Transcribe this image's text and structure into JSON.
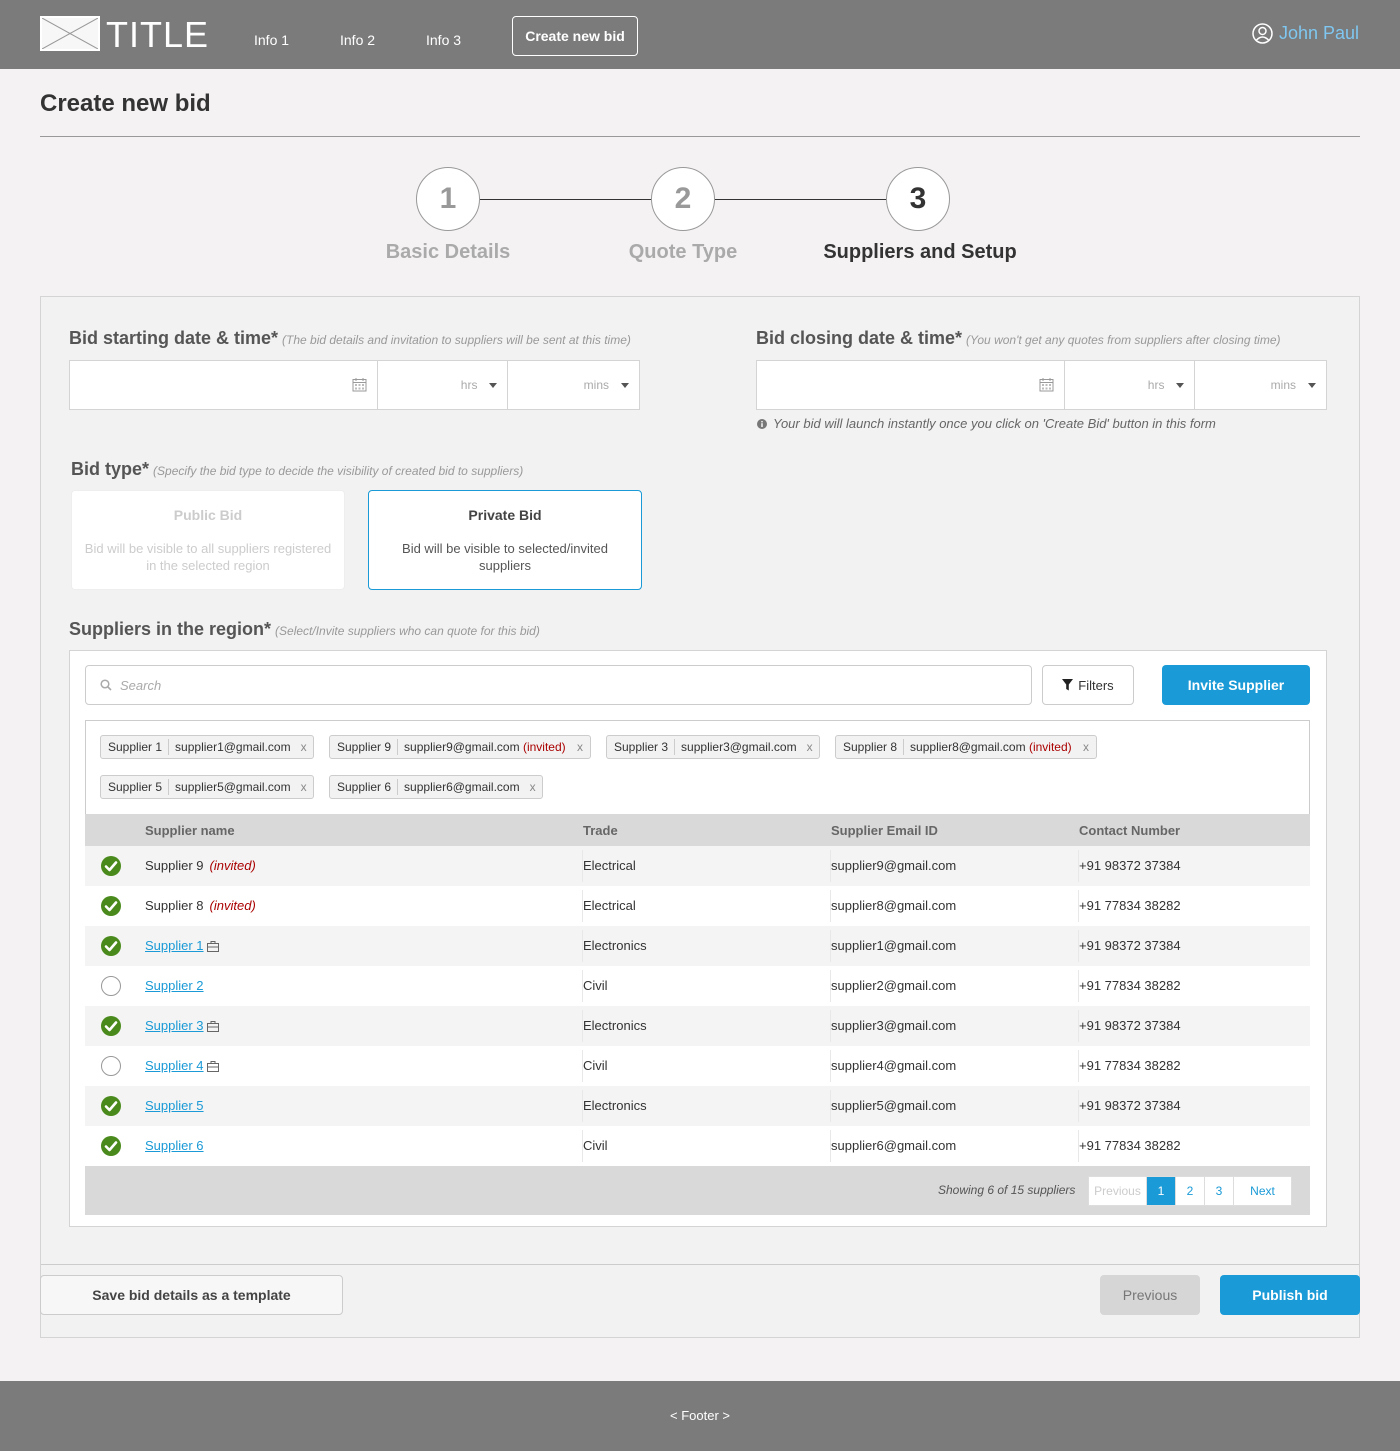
{
  "header": {
    "brand": "TITLE",
    "nav": [
      "Info 1",
      "Info 2",
      "Info 3"
    ],
    "create_button": "Create new bid",
    "user_name": "John Paul"
  },
  "page": {
    "title": "Create new bid"
  },
  "stepper": {
    "steps": [
      {
        "number": "1",
        "label": "Basic Details"
      },
      {
        "number": "2",
        "label": "Quote Type"
      },
      {
        "number": "3",
        "label": "Suppliers and Setup"
      }
    ],
    "active_step": 3
  },
  "form": {
    "start": {
      "label": "Bid starting date & time*",
      "hint": "(The bid details and invitation to suppliers will be sent at this time)",
      "hrs": "hrs",
      "mins": "mins"
    },
    "close": {
      "label": "Bid closing date & time*",
      "hint": "(You won't get any quotes from suppliers after closing time)",
      "hrs": "hrs",
      "mins": "mins",
      "note": "Your bid will launch instantly once you click on 'Create Bid' button in this form"
    },
    "bid_type": {
      "label": "Bid type*",
      "hint": "(Specify the bid type to decide the visibility of created bid to suppliers)",
      "public_title": "Public Bid",
      "public_desc": "Bid will be visible to all suppliers registered in the selected region",
      "private_title": "Private Bid",
      "private_desc": "Bid will be visible to selected/invited suppliers",
      "selected": "Private Bid"
    },
    "suppliers": {
      "label": "Suppliers in the region*",
      "hint": "(Select/Invite suppliers who can quote for this bid)",
      "search_placeholder": "Search",
      "filters_label": "Filters",
      "invite_label": "Invite Supplier"
    }
  },
  "tags": [
    {
      "name": "Supplier 1",
      "email": "supplier1@gmail.com",
      "invited": ""
    },
    {
      "name": "Supplier 9",
      "email": "supplier9@gmail.com",
      "invited": "(invited)"
    },
    {
      "name": "Supplier 3",
      "email": "supplier3@gmail.com",
      "invited": ""
    },
    {
      "name": "Supplier 8",
      "email": "supplier8@gmail.com",
      "invited": "(invited)"
    },
    {
      "name": "Supplier 5",
      "email": "supplier5@gmail.com",
      "invited": ""
    },
    {
      "name": "Supplier 6",
      "email": "supplier6@gmail.com",
      "invited": ""
    }
  ],
  "tag_remove": "x",
  "table": {
    "headers": [
      "Supplier name",
      "Trade",
      "Supplier Email ID",
      "Contact Number"
    ],
    "rows": [
      {
        "name": "Supplier 9",
        "invited": "(invited)",
        "trade": "Electrical",
        "email": "supplier9@gmail.com",
        "phone": "+91 98372 37384",
        "checked": true,
        "link": false,
        "briefcase": false
      },
      {
        "name": "Supplier 8",
        "invited": "(invited)",
        "trade": "Electrical",
        "email": "supplier8@gmail.com",
        "phone": "+91 77834 38282",
        "checked": true,
        "link": false,
        "briefcase": false
      },
      {
        "name": "Supplier 1",
        "invited": "",
        "trade": "Electronics",
        "email": "supplier1@gmail.com",
        "phone": "+91 98372 37384",
        "checked": true,
        "link": true,
        "briefcase": true
      },
      {
        "name": "Supplier 2",
        "invited": "",
        "trade": "Civil",
        "email": "supplier2@gmail.com",
        "phone": "+91 77834 38282",
        "checked": false,
        "link": true,
        "briefcase": false
      },
      {
        "name": "Supplier 3",
        "invited": "",
        "trade": "Electronics",
        "email": "supplier3@gmail.com",
        "phone": "+91 98372 37384",
        "checked": true,
        "link": true,
        "briefcase": true
      },
      {
        "name": "Supplier 4",
        "invited": "",
        "trade": "Civil",
        "email": "supplier4@gmail.com",
        "phone": "+91 77834 38282",
        "checked": false,
        "link": true,
        "briefcase": true
      },
      {
        "name": "Supplier 5",
        "invited": "",
        "trade": "Electronics",
        "email": "supplier5@gmail.com",
        "phone": "+91 98372 37384",
        "checked": true,
        "link": true,
        "briefcase": false
      },
      {
        "name": "Supplier 6",
        "invited": "",
        "trade": "Civil",
        "email": "supplier6@gmail.com",
        "phone": "+91 77834 38282",
        "checked": true,
        "link": true,
        "briefcase": false
      }
    ],
    "showing": "Showing 6 of 15 suppliers",
    "pager": {
      "previous": "Previous",
      "pages": [
        "1",
        "2",
        "3"
      ],
      "current": "1",
      "next": "Next"
    }
  },
  "actions": {
    "template": "Save bid details as a template",
    "previous": "Previous",
    "publish": "Publish bid"
  },
  "footer": "< Footer >",
  "colors": {
    "accent": "#1a9ad6",
    "header_bg": "#7b7b7b",
    "check_green": "#4a8a1c",
    "invited_red": "#aa0000",
    "user_link": "#7fc7f0"
  }
}
